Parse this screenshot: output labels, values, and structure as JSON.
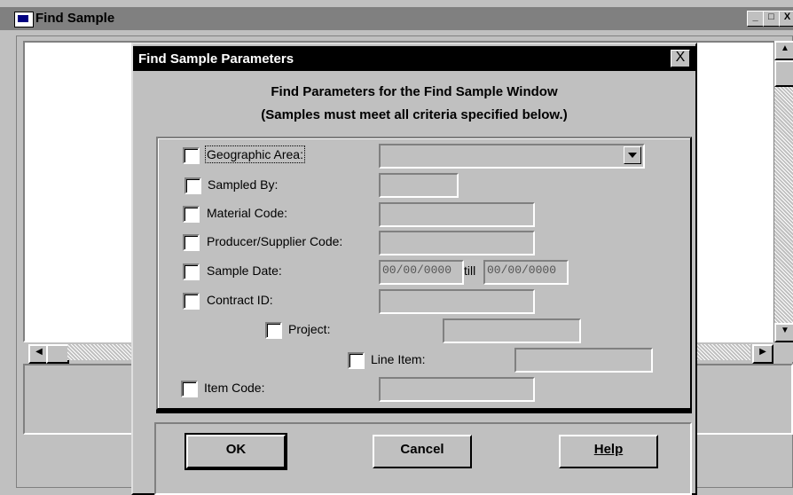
{
  "main_window": {
    "title": "Find Sample",
    "caption_buttons": [
      "_",
      "□",
      "X"
    ]
  },
  "dialog": {
    "title": "Find Sample Parameters",
    "close_label": "X",
    "heading_line1": "Find Parameters for the Find Sample Window",
    "heading_line2": "(Samples must meet all criteria specified below.)",
    "criteria": {
      "geographic_area": {
        "label": "Geographic Area:",
        "checked": false,
        "value": ""
      },
      "sampled_by": {
        "label": "Sampled By:",
        "checked": false,
        "value": ""
      },
      "material_code": {
        "label": "Material Code:",
        "checked": false,
        "value": ""
      },
      "producer_supplier_code": {
        "label": "Producer/Supplier Code:",
        "checked": false,
        "value": ""
      },
      "sample_date": {
        "label": "Sample Date:",
        "checked": false,
        "from": "00/00/0000",
        "till_label": "till",
        "to": "00/00/0000"
      },
      "contract_id": {
        "label": "Contract ID:",
        "checked": false,
        "value": ""
      },
      "project": {
        "label": "Project:",
        "checked": false,
        "value": ""
      },
      "line_item": {
        "label": "Line Item:",
        "checked": false,
        "value": ""
      },
      "item_code": {
        "label": "Item Code:",
        "checked": false,
        "value": ""
      }
    },
    "buttons": {
      "ok": "OK",
      "cancel": "Cancel",
      "help": "Help"
    }
  }
}
